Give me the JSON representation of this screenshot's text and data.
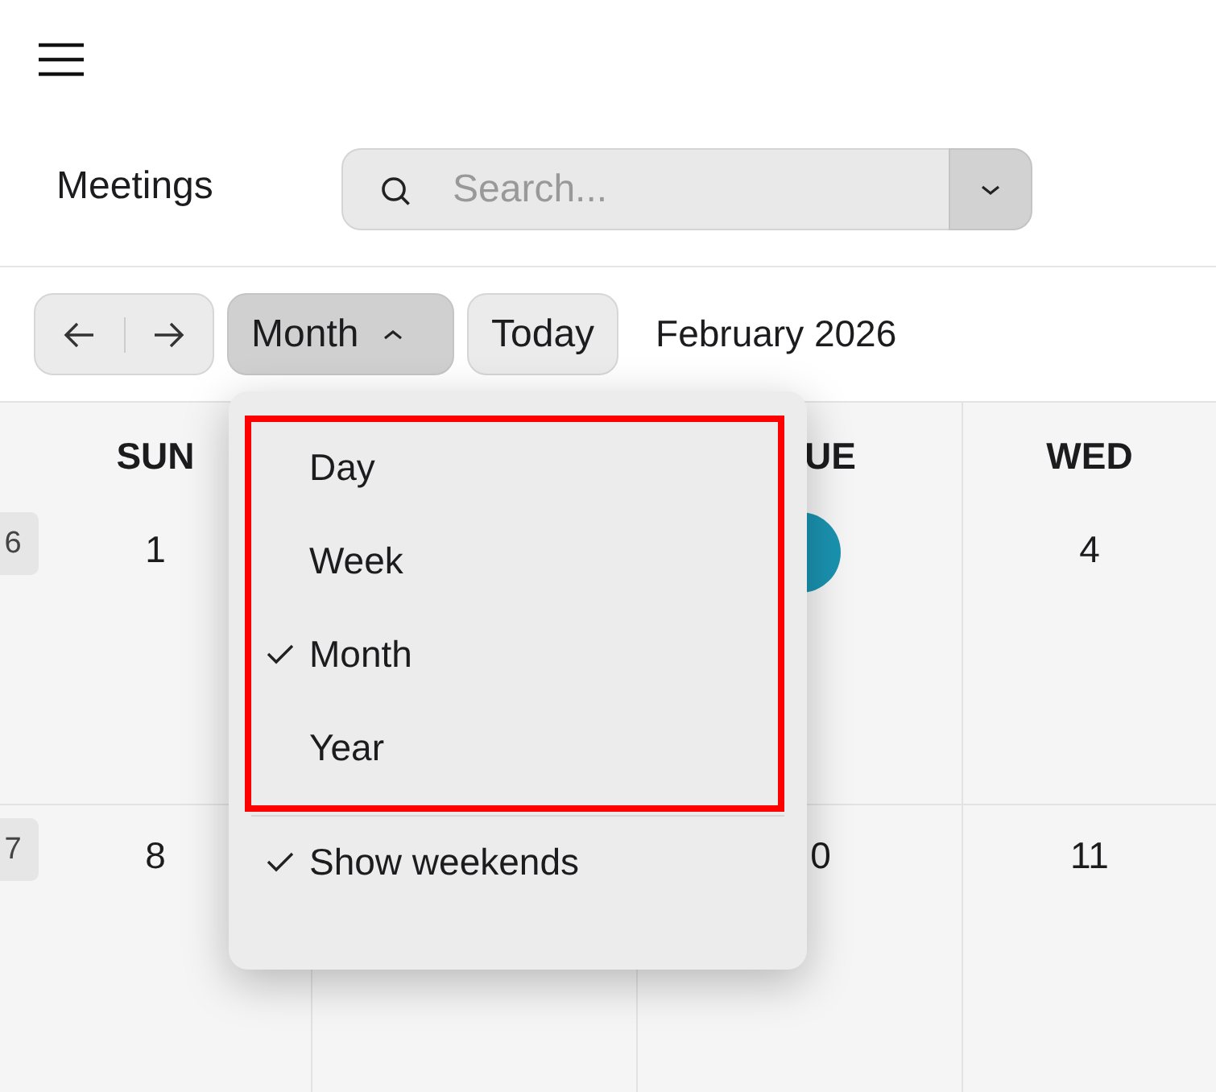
{
  "title": "Meetings",
  "search": {
    "placeholder": "Search..."
  },
  "toolbar": {
    "view_button": {
      "label": "Month",
      "expanded": true
    },
    "today_button": "Today",
    "period": "February 2026"
  },
  "calendar": {
    "day_headers": [
      "SUN",
      "UE",
      "WED"
    ],
    "weeks": [
      {
        "week": "6",
        "days": [
          {
            "date": "1",
            "today": false
          },
          {
            "today": true
          },
          {
            "date": "4",
            "today": false
          }
        ]
      },
      {
        "week": "7",
        "days": [
          {
            "date": "8",
            "today": false
          },
          {
            "date": "0",
            "today": false
          },
          {
            "date": "11",
            "today": false
          }
        ]
      }
    ]
  },
  "view_menu": {
    "highlighted": true,
    "items": [
      {
        "label": "Day",
        "checked": false
      },
      {
        "label": "Week",
        "checked": false
      },
      {
        "label": "Month",
        "checked": true
      },
      {
        "label": "Year",
        "checked": false
      }
    ],
    "options": [
      {
        "label": "Show weekends",
        "checked": true
      }
    ]
  }
}
